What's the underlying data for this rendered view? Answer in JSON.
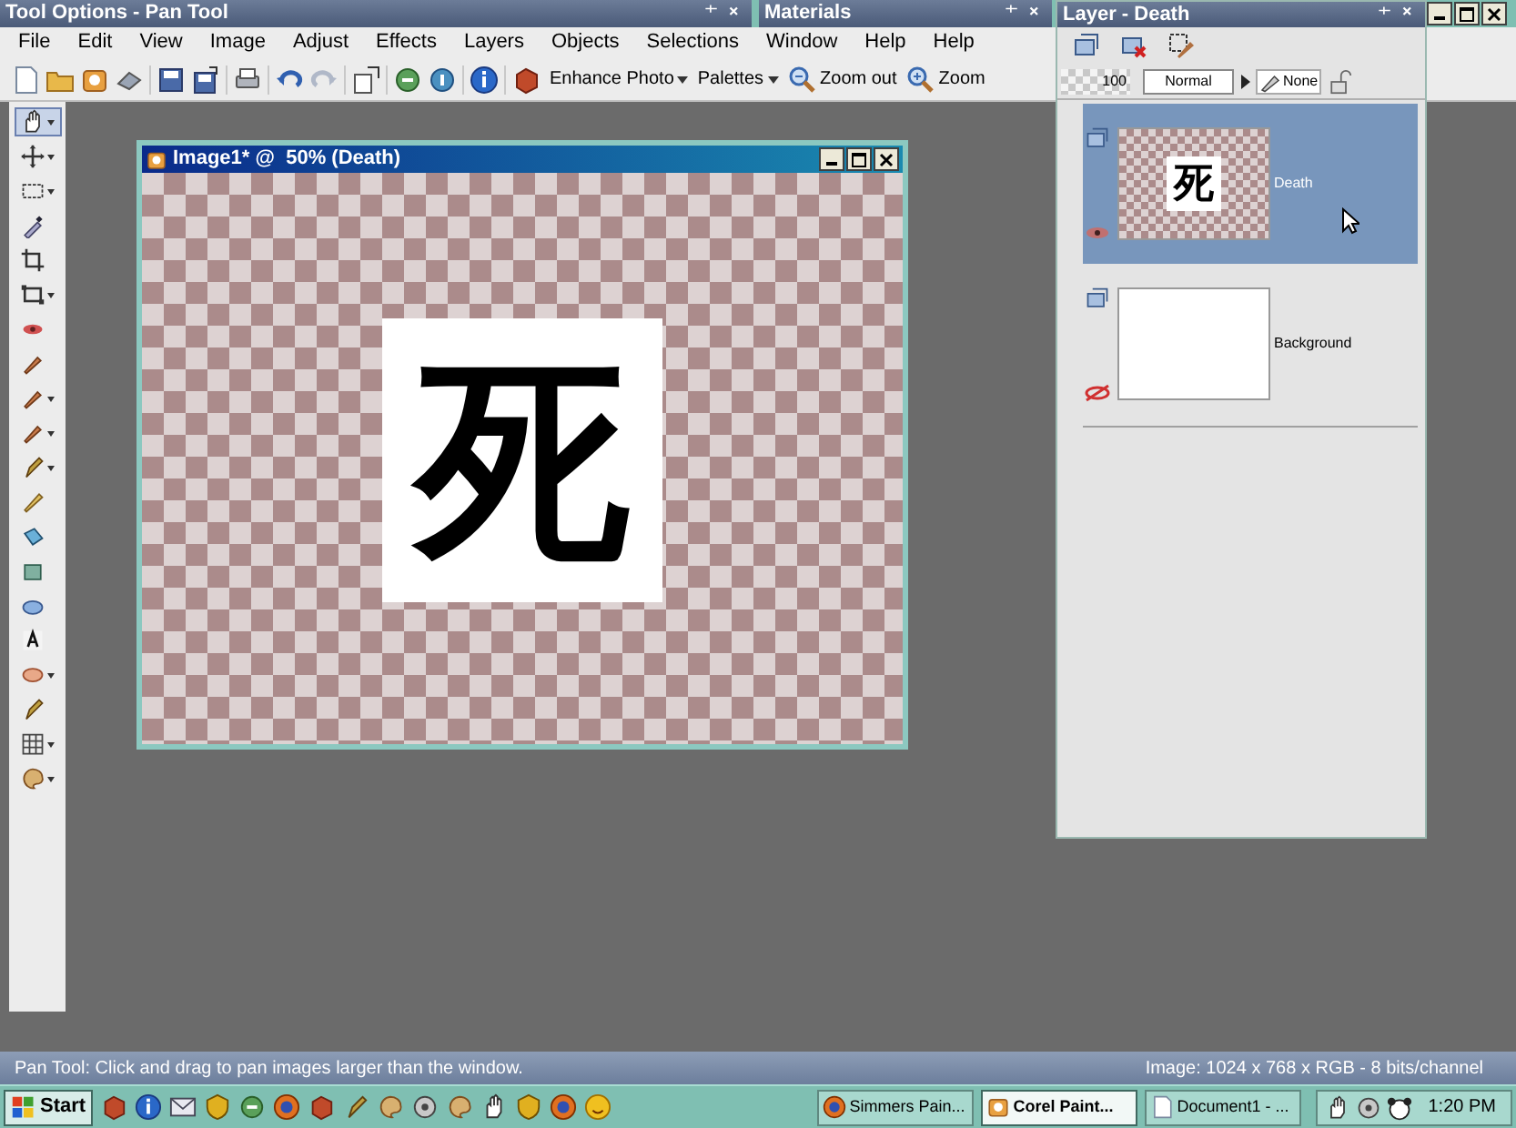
{
  "tool_options_bar": {
    "title": "Tool Options - Pan Tool"
  },
  "materials_bar": {
    "title": "Materials"
  },
  "menu": [
    "File",
    "Edit",
    "View",
    "Image",
    "Adjust",
    "Effects",
    "Layers",
    "Objects",
    "Selections",
    "Window",
    "Help",
    "Help"
  ],
  "toolbar": {
    "buttons": [
      {
        "label": "Enhance Photo",
        "kind": "dropdown"
      },
      {
        "label": "Palettes",
        "kind": "dropdown"
      },
      {
        "label": "Zoom out",
        "kind": "zoom-out"
      },
      {
        "label": "Zoom",
        "kind": "zoom-in"
      }
    ]
  },
  "tools": [
    {
      "selected": true
    },
    {
      "selected": false
    },
    {
      "selected": false
    },
    {
      "selected": false
    },
    {
      "selected": false
    },
    {
      "selected": false
    },
    {
      "selected": false
    },
    {
      "selected": false
    },
    {
      "selected": false
    },
    {
      "selected": false
    },
    {
      "selected": false
    },
    {
      "selected": false
    },
    {
      "selected": false
    },
    {
      "selected": false
    },
    {
      "selected": false
    },
    {
      "selected": false
    },
    {
      "selected": false
    },
    {
      "selected": false
    },
    {
      "selected": false
    },
    {
      "selected": false
    }
  ],
  "image_window": {
    "title": "Image1* @  50% (Death)",
    "glyph": "死"
  },
  "layer_palette": {
    "title": "Layer - Death",
    "opacity": "100",
    "blend_mode": "Normal",
    "mask": "None",
    "layers": [
      {
        "name": "Death",
        "selected": true,
        "visible": true,
        "thumbnail_glyph": "死"
      },
      {
        "name": "Background",
        "selected": false,
        "visible": false
      }
    ]
  },
  "status_bar": {
    "message": "Pan Tool: Click and drag to pan images larger than the window.",
    "image_info": "Image:  1024 x 768 x RGB - 8 bits/channel"
  },
  "taskbar": {
    "start": "Start",
    "tasks": [
      {
        "label": "Simmers Pain...",
        "selected": false
      },
      {
        "label": "Corel Paint...",
        "selected": true
      },
      {
        "label": "Document1 - ...",
        "selected": false
      }
    ],
    "clock": "1:20 PM"
  }
}
